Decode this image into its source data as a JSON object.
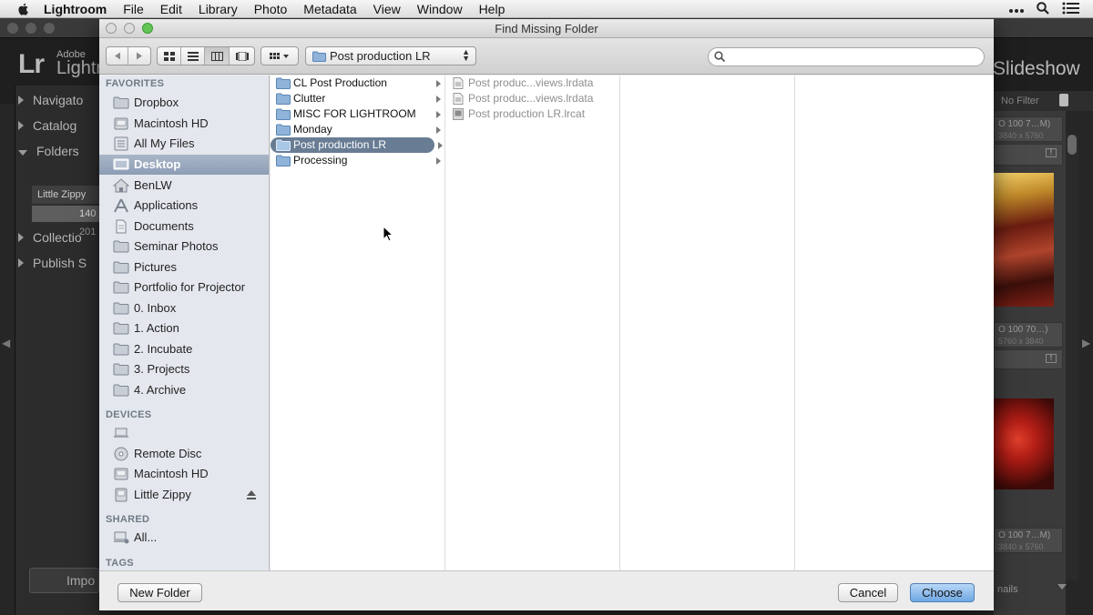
{
  "menubar": {
    "app": "Lightroom",
    "items": [
      "File",
      "Edit",
      "Library",
      "Photo",
      "Metadata",
      "View",
      "Window",
      "Help"
    ]
  },
  "lightroom": {
    "logo": "Lr",
    "brand_small": "Adobe",
    "brand": "Lightr",
    "module": "Slideshow",
    "panels": [
      "Navigato",
      "Catalog",
      "Folders",
      "Collectio",
      "Publish S"
    ],
    "volume": "Little Zippy",
    "folder_1": "140",
    "folder_2": "201",
    "import": "Impo",
    "filter": "No Filter",
    "cells": [
      {
        "meta": "O 100   7…M)",
        "dim": "3840 x 5760"
      },
      {
        "meta": "O 100   70…)",
        "dim": "5760 x 3840"
      },
      {
        "meta": "O 100   7…M)",
        "dim": "3840 x 5760"
      }
    ],
    "bottom_label": "nails"
  },
  "dialog": {
    "title": "Find Missing Folder",
    "path": "Post production LR",
    "search_placeholder": "",
    "sidebar": {
      "favorites_label": "FAVORITES",
      "favorites": [
        {
          "label": "Dropbox",
          "icon": "folder-icon"
        },
        {
          "label": "Macintosh HD",
          "icon": "hard-drive-icon"
        },
        {
          "label": "All My Files",
          "icon": "all-files-icon"
        },
        {
          "label": "Desktop",
          "icon": "desktop-icon",
          "selected": true
        },
        {
          "label": "BenLW",
          "icon": "home-icon"
        },
        {
          "label": "Applications",
          "icon": "applications-icon"
        },
        {
          "label": "Documents",
          "icon": "documents-icon"
        },
        {
          "label": "Seminar Photos",
          "icon": "folder-icon"
        },
        {
          "label": "Pictures",
          "icon": "folder-icon"
        },
        {
          "label": "Portfolio for Projector",
          "icon": "folder-icon"
        },
        {
          "label": "0. Inbox",
          "icon": "folder-icon"
        },
        {
          "label": "1. Action",
          "icon": "folder-icon"
        },
        {
          "label": "2. Incubate",
          "icon": "folder-icon"
        },
        {
          "label": "3. Projects",
          "icon": "folder-icon"
        },
        {
          "label": "4. Archive",
          "icon": "folder-icon"
        }
      ],
      "devices_label": "DEVICES",
      "devices": [
        {
          "label": "",
          "icon": "laptop-icon"
        },
        {
          "label": "Remote Disc",
          "icon": "disc-icon"
        },
        {
          "label": "Macintosh HD",
          "icon": "hard-drive-icon"
        },
        {
          "label": "Little Zippy",
          "icon": "external-drive-icon",
          "eject": true
        }
      ],
      "shared_label": "SHARED",
      "shared": [
        {
          "label": "All...",
          "icon": "network-icon"
        }
      ],
      "tags_label": "TAGS"
    },
    "column1": [
      {
        "label": "CL Post Production"
      },
      {
        "label": "Clutter"
      },
      {
        "label": "MISC FOR LIGHTROOM"
      },
      {
        "label": "Monday"
      },
      {
        "label": "Post production LR",
        "selected": true
      },
      {
        "label": "Processing"
      }
    ],
    "column2": [
      {
        "label": "Post produc...views.lrdata",
        "icon": "lrdata-icon"
      },
      {
        "label": "Post produc...views.lrdata",
        "icon": "lrdata-icon"
      },
      {
        "label": "Post production LR.lrcat",
        "icon": "lrcat-icon"
      }
    ],
    "buttons": {
      "new_folder": "New Folder",
      "cancel": "Cancel",
      "choose": "Choose"
    }
  },
  "colors": {
    "selection": "#687c94",
    "sidebar_bg": "#e4e8ee",
    "default_button": "#6fa7e3",
    "lightroom_bg": "#262626"
  }
}
